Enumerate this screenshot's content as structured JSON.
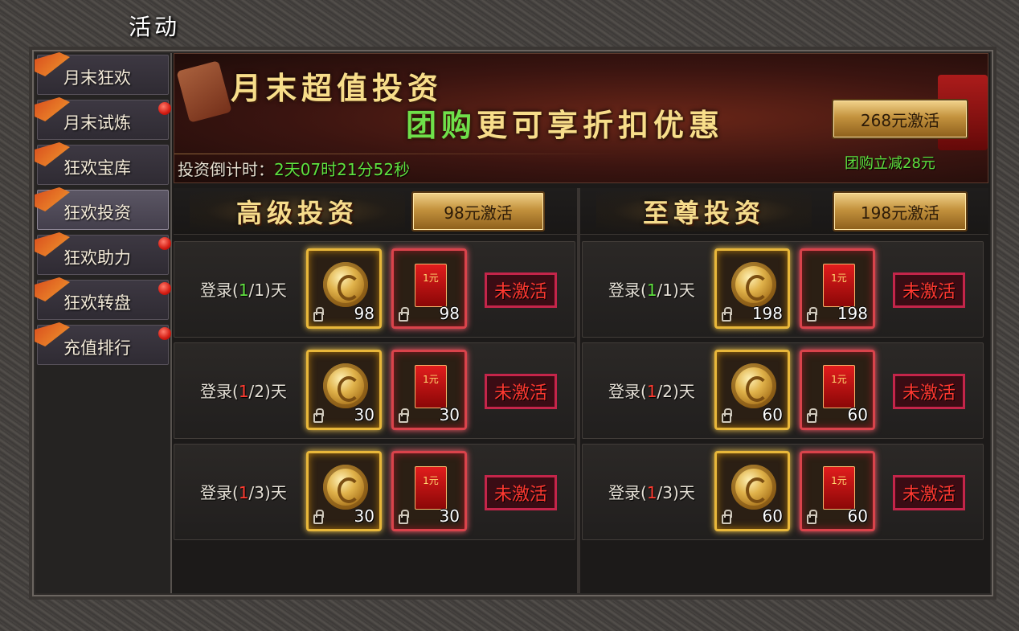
{
  "window": {
    "title": "活动"
  },
  "sidebar": {
    "items": [
      {
        "label": "月末狂欢",
        "active": false,
        "badge": false
      },
      {
        "label": "月末试炼",
        "active": false,
        "badge": true
      },
      {
        "label": "狂欢宝库",
        "active": false,
        "badge": false
      },
      {
        "label": "狂欢投资",
        "active": true,
        "badge": false
      },
      {
        "label": "狂欢助力",
        "active": false,
        "badge": true
      },
      {
        "label": "狂欢转盘",
        "active": false,
        "badge": true
      },
      {
        "label": "充值排行",
        "active": false,
        "badge": true
      }
    ]
  },
  "banner": {
    "headline": "月末超值投资",
    "sub_green": "团购",
    "sub_rest": "更可享折扣优惠",
    "countdown_label": "投资倒计时：",
    "countdown_value": "2天07时21分52秒",
    "activate_label": "268元激活",
    "discount_text": "团购立减28元"
  },
  "sections": [
    {
      "title": "高级投资",
      "activate_label": "98元激活",
      "rows": [
        {
          "login_prefix": "登录(",
          "login_current": "1",
          "login_current_color": "green",
          "login_suffix": "/1)天",
          "coin_qty": "98",
          "envelope_qty": "98",
          "status": "未激活"
        },
        {
          "login_prefix": "登录(",
          "login_current": "1",
          "login_current_color": "red",
          "login_suffix": "/2)天",
          "coin_qty": "30",
          "envelope_qty": "30",
          "status": "未激活"
        },
        {
          "login_prefix": "登录(",
          "login_current": "1",
          "login_current_color": "red",
          "login_suffix": "/3)天",
          "coin_qty": "30",
          "envelope_qty": "30",
          "status": "未激活"
        }
      ]
    },
    {
      "title": "至尊投资",
      "activate_label": "198元激活",
      "rows": [
        {
          "login_prefix": "登录(",
          "login_current": "1",
          "login_current_color": "green",
          "login_suffix": "/1)天",
          "coin_qty": "198",
          "envelope_qty": "198",
          "status": "未激活"
        },
        {
          "login_prefix": "登录(",
          "login_current": "1",
          "login_current_color": "red",
          "login_suffix": "/2)天",
          "coin_qty": "60",
          "envelope_qty": "60",
          "status": "未激活"
        },
        {
          "login_prefix": "登录(",
          "login_current": "1",
          "login_current_color": "red",
          "login_suffix": "/3)天",
          "coin_qty": "60",
          "envelope_qty": "60",
          "status": "未激活"
        }
      ]
    }
  ],
  "envelope_label": "1元",
  "colors": {
    "green": "#5fe03f",
    "red": "#ff3b30",
    "gold": "#f7dd8a"
  },
  "icons": {
    "coin": "gold-coin-icon",
    "envelope": "red-envelope-icon",
    "lock": "lock-icon",
    "ribbon": "ribbon-icon",
    "badge": "red-dot-badge"
  }
}
